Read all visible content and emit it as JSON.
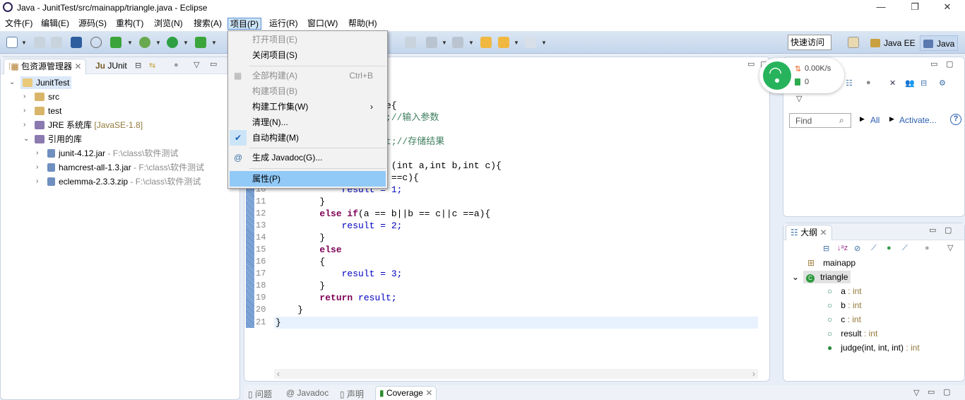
{
  "window": {
    "title": "Java  -  JunitTest/src/mainapp/triangle.java  -  Eclipse",
    "min": "—",
    "restore": "❐",
    "close": "✕"
  },
  "menubar": [
    "文件(F)",
    "编辑(E)",
    "源码(S)",
    "重构(T)",
    "浏览(N)",
    "搜索(A)",
    "项目(P)",
    "运行(R)",
    "窗口(W)",
    "帮助(H)"
  ],
  "toolbar": {
    "quick_access": "快速访问",
    "perspectives": [
      "Java EE",
      "Java"
    ]
  },
  "project_menu": {
    "items": [
      {
        "label": "打开项目(E)",
        "disabled": true
      },
      {
        "label": "关闭项目(S)"
      },
      {
        "label": "全部构建(A)",
        "shortcut": "Ctrl+B",
        "disabled": true
      },
      {
        "label": "构建项目(B)",
        "disabled": true
      },
      {
        "label": "构建工作集(W)",
        "submenu": "›"
      },
      {
        "label": "清理(N)..."
      },
      {
        "label": "自动构建(M)",
        "checked": "✔"
      },
      {
        "label": "生成 Javadoc(G)..."
      },
      {
        "label": "属性(P)",
        "highlighted": true
      }
    ]
  },
  "explorer": {
    "tabs": [
      "包资源管理器",
      "JUnit"
    ],
    "tree": [
      {
        "label": "JunitTest"
      },
      {
        "label": "src"
      },
      {
        "label": "test"
      },
      {
        "label": "JRE 系统库",
        "extra": "[JavaSE-1.8]"
      },
      {
        "label": "引用的库"
      },
      {
        "label": "junit-4.12.jar",
        "extra": "- F:\\class\\软件测试"
      },
      {
        "label": "hamcrest-all-1.3.jar",
        "extra": "- F:\\class\\软件测试"
      },
      {
        "label": "eclemma-2.3.3.zip",
        "extra": "- F:\\class\\软件测试"
      }
    ]
  },
  "editor": {
    "lines": {
      "3": "e{",
      "4": ";//输入参数",
      "6": "t;//存储结果",
      "8": "(int a,int b,int c){",
      "9": "==c){",
      "10": "result = 1;",
      "11": "}",
      "12a": "else if",
      "12b": "(a == b||b == c||c ==a){",
      "13": "result = 2;",
      "14": "}",
      "15": "else",
      "16": "{",
      "17": "result = 3;",
      "18": "}",
      "19a": "return",
      "19b": "result;",
      "20": "}",
      "21": "}"
    },
    "line_numbers": [
      "10",
      "11",
      "12",
      "13",
      "14",
      "15",
      "16",
      "17",
      "18",
      "19",
      "20",
      "21"
    ]
  },
  "task_panel": {
    "find_placeholder": "Find",
    "all": "All",
    "activate": "Activate...",
    "help": "?"
  },
  "net_widget": {
    "speed": "0.00K/s",
    "count": "0"
  },
  "outline": {
    "title": "大纲",
    "items": [
      {
        "name": "mainapp"
      },
      {
        "name": "triangle"
      },
      {
        "name": "a",
        "type": ": int"
      },
      {
        "name": "b",
        "type": ": int"
      },
      {
        "name": "c",
        "type": ": int"
      },
      {
        "name": "result",
        "type": ": int"
      },
      {
        "name": "judge(int, int, int)",
        "type": ": int"
      }
    ]
  },
  "bottom_tabs": [
    "问题",
    "Javadoc",
    "声明",
    "Coverage"
  ]
}
